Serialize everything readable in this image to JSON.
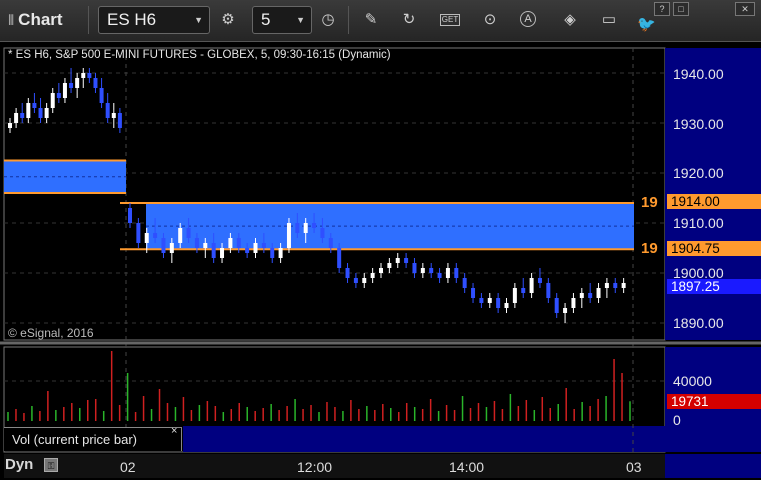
{
  "toolbar": {
    "title": "Chart",
    "symbol": "ES H6",
    "interval": "5",
    "icons": [
      "refresh-gear-icon",
      "clock-icon",
      "pencil-icon",
      "cycle-icon",
      "get-icon",
      "play-icon",
      "a-circle-icon",
      "tag-icon",
      "comment-icon",
      "twitter-icon"
    ],
    "get_label": "GET",
    "window_buttons": [
      "?",
      "□",
      "✕"
    ]
  },
  "chart": {
    "description": "* ES H6, S&P 500 E-MINI FUTURES - GLOBEX, 5, 09:30-16:15 (Dynamic)",
    "copyright": "© eSignal, 2016"
  },
  "price_axis": {
    "labels": [
      "1940.00",
      "1930.00",
      "1920.00",
      "1910.00",
      "1900.00",
      "1890.00"
    ]
  },
  "levels": {
    "upper_num": "19",
    "upper_tag": "1914.00",
    "lower_num": "19",
    "lower_tag": "1904.75",
    "current_price": "1897.25",
    "colors": {
      "orange": "#ff9a2e",
      "blue_zone": "#2f6fff",
      "price_tag": "#1a1aff"
    }
  },
  "volume": {
    "label": "Vol (current price bar)",
    "close_glyph": "×",
    "axis_labels": [
      "40000",
      "0"
    ],
    "current_value": "19731",
    "tag_color": "#d40000"
  },
  "time_axis": {
    "labels": [
      "02",
      "12:00",
      "14:00",
      "03"
    ]
  },
  "footer": {
    "dyn_label": "Dyn",
    "lock_glyph": "🔒"
  },
  "chart_data": {
    "type": "candlestick",
    "ylim": [
      1885,
      1945
    ],
    "upper_zone": [
      1904.75,
      1914.0
    ],
    "previous_zone": [
      1916.0,
      1922.5
    ],
    "current_price": 1897.25,
    "candles": [
      [
        1929,
        1931,
        1928,
        1930
      ],
      [
        1930,
        1933,
        1929,
        1932
      ],
      [
        1932,
        1934,
        1930,
        1931
      ],
      [
        1931,
        1935,
        1930,
        1934
      ],
      [
        1934,
        1936,
        1932,
        1933
      ],
      [
        1933,
        1935,
        1930,
        1931
      ],
      [
        1931,
        1934,
        1930,
        1933
      ],
      [
        1933,
        1937,
        1932,
        1936
      ],
      [
        1936,
        1938,
        1934,
        1935
      ],
      [
        1935,
        1939,
        1934,
        1938
      ],
      [
        1938,
        1941,
        1936,
        1937
      ],
      [
        1937,
        1940,
        1935,
        1939
      ],
      [
        1939,
        1941,
        1937,
        1940
      ],
      [
        1940,
        1941,
        1938,
        1939
      ],
      [
        1939,
        1940,
        1936,
        1937
      ],
      [
        1937,
        1939,
        1933,
        1934
      ],
      [
        1934,
        1936,
        1930,
        1931
      ],
      [
        1931,
        1934,
        1929,
        1932
      ],
      [
        1932,
        1933,
        1928,
        1929
      ],
      [
        1913,
        1914,
        1909,
        1910
      ],
      [
        1910,
        1911,
        1905,
        1906
      ],
      [
        1906,
        1909,
        1904,
        1908
      ],
      [
        1908,
        1911,
        1906,
        1907
      ],
      [
        1907,
        1908,
        1903,
        1904
      ],
      [
        1904,
        1907,
        1902,
        1906
      ],
      [
        1906,
        1910,
        1905,
        1909
      ],
      [
        1909,
        1911,
        1906,
        1907
      ],
      [
        1907,
        1908,
        1904,
        1905
      ],
      [
        1905,
        1907,
        1903,
        1906
      ],
      [
        1906,
        1908,
        1902,
        1903
      ],
      [
        1903,
        1906,
        1902,
        1905
      ],
      [
        1905,
        1908,
        1904,
        1907
      ],
      [
        1907,
        1908,
        1904,
        1905
      ],
      [
        1905,
        1906,
        1903,
        1904
      ],
      [
        1904,
        1907,
        1903,
        1906
      ],
      [
        1906,
        1908,
        1904,
        1905
      ],
      [
        1905,
        1906,
        1902,
        1903
      ],
      [
        1903,
        1906,
        1902,
        1905
      ],
      [
        1905,
        1911,
        1904,
        1910
      ],
      [
        1910,
        1912,
        1907,
        1908
      ],
      [
        1908,
        1911,
        1906,
        1910
      ],
      [
        1910,
        1912,
        1908,
        1909
      ],
      [
        1909,
        1911,
        1906,
        1907
      ],
      [
        1907,
        1908,
        1904,
        1905
      ],
      [
        1905,
        1906,
        1900,
        1901
      ],
      [
        1901,
        1902,
        1898,
        1899
      ],
      [
        1899,
        1900,
        1897,
        1898
      ],
      [
        1898,
        1900,
        1897,
        1899
      ],
      [
        1899,
        1901,
        1898,
        1900
      ],
      [
        1900,
        1902,
        1899,
        1901
      ],
      [
        1901,
        1903,
        1900,
        1902
      ],
      [
        1902,
        1904,
        1901,
        1903
      ],
      [
        1903,
        1904,
        1901,
        1902
      ],
      [
        1902,
        1903,
        1899,
        1900
      ],
      [
        1900,
        1902,
        1899,
        1901
      ],
      [
        1901,
        1902,
        1899,
        1900
      ],
      [
        1900,
        1901,
        1898,
        1899
      ],
      [
        1899,
        1902,
        1898,
        1901
      ],
      [
        1901,
        1902,
        1898,
        1899
      ],
      [
        1899,
        1900,
        1896,
        1897
      ],
      [
        1897,
        1898,
        1894,
        1895
      ],
      [
        1895,
        1896,
        1893,
        1894
      ],
      [
        1894,
        1896,
        1893,
        1895
      ],
      [
        1895,
        1896,
        1892,
        1893
      ],
      [
        1893,
        1895,
        1892,
        1894
      ],
      [
        1894,
        1898,
        1893,
        1897
      ],
      [
        1897,
        1899,
        1895,
        1896
      ],
      [
        1896,
        1900,
        1895,
        1899
      ],
      [
        1899,
        1901,
        1897,
        1898
      ],
      [
        1898,
        1899,
        1894,
        1895
      ],
      [
        1895,
        1896,
        1891,
        1892
      ],
      [
        1892,
        1894,
        1890,
        1893
      ],
      [
        1893,
        1896,
        1892,
        1895
      ],
      [
        1895,
        1897,
        1893,
        1896
      ],
      [
        1896,
        1898,
        1894,
        1895
      ],
      [
        1895,
        1898,
        1894,
        1897
      ],
      [
        1897,
        1899,
        1895,
        1898
      ],
      [
        1898,
        1899,
        1896,
        1897
      ],
      [
        1897,
        1899,
        1896,
        1898
      ]
    ],
    "volumes": [
      9000,
      12000,
      8000,
      15000,
      10000,
      30000,
      11000,
      14000,
      18000,
      13000,
      21000,
      22000,
      10000,
      70000,
      16000,
      48000,
      9000,
      25000,
      12000,
      32000,
      18000,
      14000,
      24000,
      11000,
      16000,
      20000,
      15000,
      9000,
      12000,
      18000,
      14000,
      10000,
      13000,
      17000,
      11000,
      15000,
      22000,
      12000,
      16000,
      9000,
      19000,
      14000,
      10000,
      21000,
      12000,
      15000,
      11000,
      17000,
      13000,
      9000,
      18000,
      14000,
      12000,
      22000,
      10000,
      16000,
      11000,
      25000,
      13000,
      18000,
      14000,
      20000,
      12000,
      27000,
      15000,
      21000,
      11000,
      24000,
      13000,
      17000,
      33000,
      12000,
      19000,
      15000,
      22000,
      25000,
      62000,
      48000,
      19731
    ]
  }
}
